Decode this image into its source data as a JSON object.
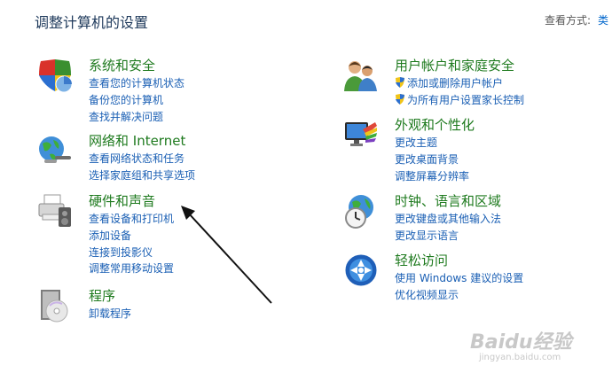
{
  "header": {
    "title": "调整计算机的设置",
    "view_by_label": "查看方式:",
    "view_by_value": "类"
  },
  "left": [
    {
      "title": "系统和安全",
      "icon": "shield-icon",
      "links": [
        "查看您的计算机状态",
        "备份您的计算机",
        "查找并解决问题"
      ]
    },
    {
      "title": "网络和 Internet",
      "icon": "network-globe-icon",
      "links": [
        "查看网络状态和任务",
        "选择家庭组和共享选项"
      ]
    },
    {
      "title": "硬件和声音",
      "icon": "printer-speaker-icon",
      "links": [
        "查看设备和打印机",
        "添加设备",
        "连接到投影仪",
        "调整常用移动设置"
      ]
    },
    {
      "title": "程序",
      "icon": "programs-disc-icon",
      "links": [
        "卸载程序"
      ]
    }
  ],
  "right": [
    {
      "title": "用户帐户和家庭安全",
      "icon": "users-icon",
      "links": [
        "添加或删除用户帐户",
        "为所有用户设置家长控制"
      ]
    },
    {
      "title": "外观和个性化",
      "icon": "monitor-palette-icon",
      "links": [
        "更改主题",
        "更改桌面背景",
        "调整屏幕分辨率"
      ]
    },
    {
      "title": "时钟、语言和区域",
      "icon": "clock-globe-icon",
      "links": [
        "更改键盘或其他输入法",
        "更改显示语言"
      ]
    },
    {
      "title": "轻松访问",
      "icon": "ease-of-access-icon",
      "links": [
        "使用 Windows 建议的设置",
        "优化视频显示"
      ]
    }
  ],
  "watermark": {
    "main": "Baidu经验",
    "sub": "jingyan.baidu.com"
  },
  "colors": {
    "title": "#1e395b",
    "category": "#1e7a1e",
    "link": "#1a5fb4"
  }
}
